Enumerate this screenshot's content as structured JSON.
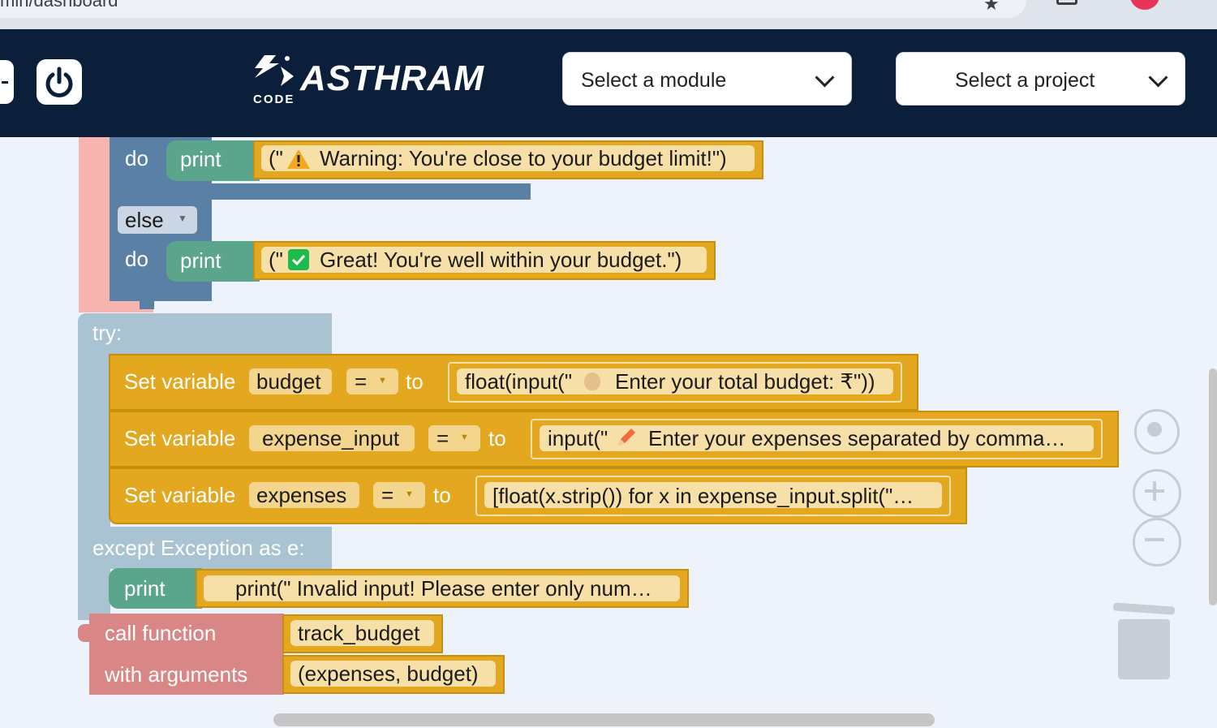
{
  "browser": {
    "url_text": "min/dashboard"
  },
  "header": {
    "brand_name": "ASTHRAM",
    "brand_sub": "CODE",
    "module_select": {
      "label": "Select a module"
    },
    "project_select": {
      "label": "Select a project"
    }
  },
  "blocks": {
    "do_label_1": "do",
    "print_label": "print",
    "warning_text": "Warning: You're close to your budget limit!\")",
    "warning_prefix": "(\"",
    "else_label": "else",
    "do_label_2": "do",
    "great_prefix": "(\"",
    "great_text": "Great! You're well within your budget.\")",
    "try_label": "try:",
    "set_variable_label": "Set variable",
    "to_label": "to",
    "eq_label": "=",
    "var_budget": "budget",
    "budget_value_prefix": "float(input(\"",
    "budget_value_text": "Enter your total budget: ₹\"))",
    "var_expense_input": "expense_input",
    "expense_input_prefix": "input(\"",
    "expense_input_text": "Enter your expenses separated by comma…",
    "var_expenses": "expenses",
    "expenses_value": "[float(x.strip()) for x in expense_input.split(\"…",
    "except_label": "except Exception as e:",
    "print_label_2": "print",
    "invalid_text": "print(\" Invalid input! Please enter only num…",
    "call_function_label": "call function",
    "function_name": "track_budget",
    "with_arguments_label": "with arguments",
    "arguments_value": "(expenses, budget)"
  },
  "colors": {
    "header_bg": "#0b1f3a",
    "workspace_bg": "#eef3fb",
    "text_block": "#e3a81f",
    "print_block": "#5ba58c",
    "logic_block": "#5b80a5",
    "try_block": "#a9c3d3",
    "function_block": "#d98686"
  }
}
